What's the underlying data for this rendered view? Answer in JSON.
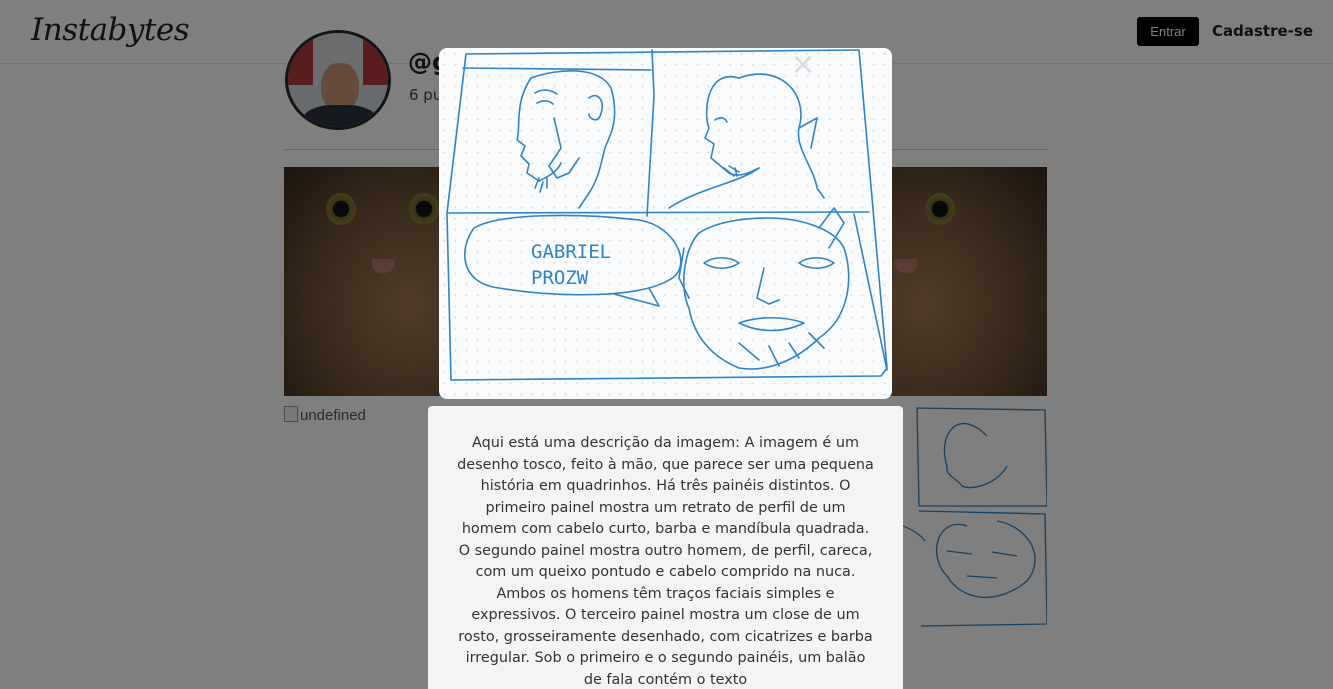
{
  "header": {
    "logo": "Instabytes",
    "login_label": "Entrar",
    "signup_label": "Cadastre-se"
  },
  "profile": {
    "username": "@g",
    "posts_count": "6 pu"
  },
  "grid": {
    "broken_image_alt": "undefined"
  },
  "modal": {
    "description": "Aqui está uma descrição da imagem: A imagem é um desenho tosco, feito à mão, que parece ser uma pequena história em quadrinhos. Há três painéis distintos. O primeiro painel mostra um retrato de perfil de um homem com cabelo curto, barba e mandíbula quadrada. O segundo painel mostra outro homem, de perfil, careca, com um queixo pontudo e cabelo comprido na nuca. Ambos os homens têm traços faciais simples e expressivos. O terceiro painel mostra um close de um rosto, grosseiramente desenhado, com cicatrizes e barba irregular. Sob o primeiro e o segundo painéis, um balão de fala contém o texto",
    "speech_bubble_line1": "GABRIEL",
    "speech_bubble_line2": "PROZW",
    "close_glyph": "×"
  },
  "colors": {
    "sketch_ink": "#2f84c6",
    "overlay": "rgba(0,0,0,0.5)",
    "login_button_bg": "#000000"
  }
}
